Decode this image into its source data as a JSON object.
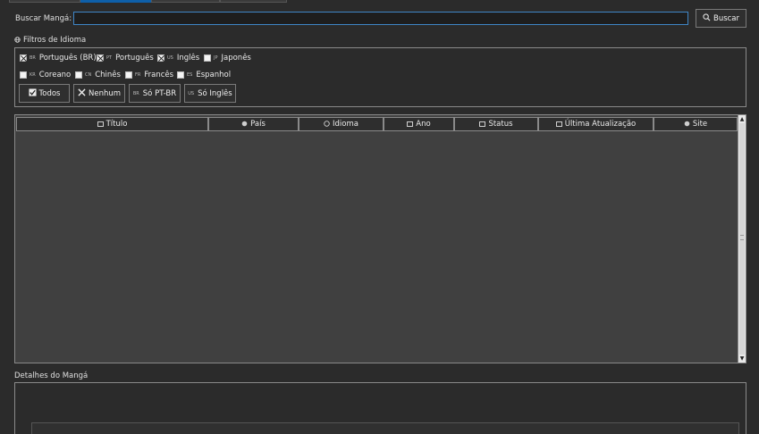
{
  "search": {
    "label": "Buscar Mangá:",
    "value": "",
    "button_label": "Buscar"
  },
  "filters": {
    "title": "Filtros de Idioma",
    "languages": [
      {
        "code": "BR",
        "label": "Português (BR)",
        "checked": true
      },
      {
        "code": "PT",
        "label": "Português",
        "checked": true
      },
      {
        "code": "US",
        "label": "Inglês",
        "checked": true
      },
      {
        "code": "JP",
        "label": "Japonês",
        "checked": false
      },
      {
        "code": "KR",
        "label": "Coreano",
        "checked": false
      },
      {
        "code": "CN",
        "label": "Chinês",
        "checked": false
      },
      {
        "code": "FR",
        "label": "Francês",
        "checked": false
      },
      {
        "code": "ES",
        "label": "Espanhol",
        "checked": false
      }
    ],
    "buttons": {
      "all": "Todos",
      "none": "Nenhum",
      "ptbr_only": "Só PT-BR",
      "en_only": "Só Inglês"
    }
  },
  "table": {
    "columns": [
      {
        "key": "titulo",
        "label": "Título",
        "icon": "table-icon"
      },
      {
        "key": "pais",
        "label": "País",
        "icon": "globe-icon"
      },
      {
        "key": "idioma",
        "label": "Idioma",
        "icon": "language-icon"
      },
      {
        "key": "ano",
        "label": "Ano",
        "icon": "calendar-icon"
      },
      {
        "key": "status",
        "label": "Status",
        "icon": "status-icon"
      },
      {
        "key": "atualizacao",
        "label": "Última Atualização",
        "icon": "update-icon"
      },
      {
        "key": "site",
        "label": "Site",
        "icon": "site-icon"
      }
    ],
    "rows": []
  },
  "details": {
    "title": "Detalhes do Mangá"
  },
  "colors": {
    "accent": "#0e5fa8",
    "background": "#2b2b2b",
    "table_body": "#404040"
  }
}
